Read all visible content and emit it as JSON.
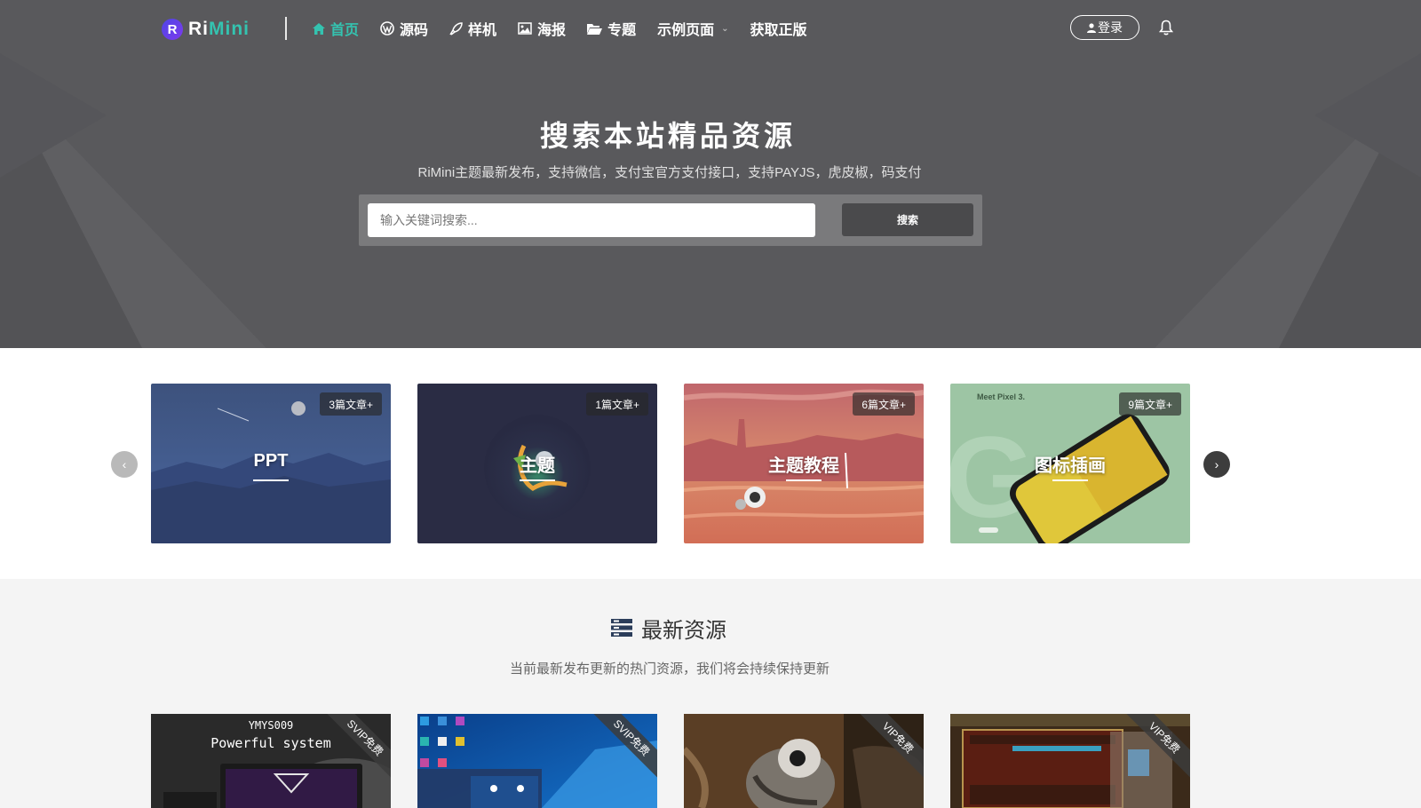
{
  "brand": {
    "letter": "R",
    "name_part1": "Ri",
    "name_part2": "Mini"
  },
  "nav": {
    "items": [
      {
        "label": "首页",
        "icon": "home-icon",
        "active": true
      },
      {
        "label": "源码",
        "icon": "wordpress-icon"
      },
      {
        "label": "样机",
        "icon": "rocket-icon"
      },
      {
        "label": "海报",
        "icon": "image-icon"
      },
      {
        "label": "专题",
        "icon": "folder-open-icon"
      },
      {
        "label": "示例页面",
        "icon": "",
        "has_dropdown": true
      },
      {
        "label": "获取正版",
        "icon": ""
      }
    ],
    "login_label": "登录"
  },
  "hero": {
    "title": "搜索本站精品资源",
    "subtitle": "RiMini主题最新发布，支持微信，支付宝官方支付接口，支持PAYJS，虎皮椒，码支付",
    "search_placeholder": "输入关键词搜索...",
    "search_button": "搜索"
  },
  "categories": [
    {
      "title": "PPT",
      "badge": "3篇文章+"
    },
    {
      "title": "主题",
      "badge": "1篇文章+"
    },
    {
      "title": "主题教程",
      "badge": "6篇文章+"
    },
    {
      "title": "图标插画",
      "badge": "9篇文章+"
    }
  ],
  "carousel": {
    "prev_symbol": "‹",
    "next_symbol": "›"
  },
  "latest": {
    "title": "最新资源",
    "subtitle": "当前最新发布更新的热门资源，我们将会持续保持更新",
    "cards": [
      {
        "ribbon": "SVIP免费",
        "line1": "YMYS009",
        "line2": "Powerful system"
      },
      {
        "ribbon": "SVIP免费"
      },
      {
        "ribbon": "VIP免费"
      },
      {
        "ribbon": "VIP免费"
      }
    ]
  },
  "colors": {
    "accent": "#34c3b0",
    "hero_bg": "#59595c"
  }
}
